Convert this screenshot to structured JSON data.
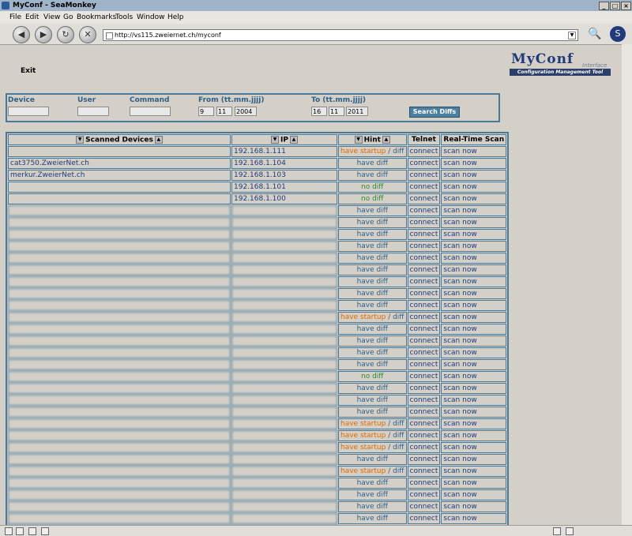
{
  "browser": {
    "title": "MyConf - SeaMonkey",
    "menus": [
      "File",
      "Edit",
      "View",
      "Go",
      "Bookmarks",
      "Tools",
      "Window",
      "Help"
    ],
    "url": "http://vs115.zweiernet.ch/myconf"
  },
  "page": {
    "exit_label": "Exit",
    "logo": {
      "name": "MyConf",
      "interface": "Interface",
      "tagline": "Configuration Management Tool"
    }
  },
  "filter": {
    "device_label": "Device",
    "user_label": "User",
    "command_label": "Command",
    "from_label": "From (tt.mm.jjjj)",
    "to_label": "To (tt.mm.jjjj)",
    "from": {
      "day": "9",
      "month": "11",
      "year": "2004"
    },
    "to": {
      "day": "16",
      "month": "11",
      "year": "2011"
    },
    "search_button": "Search Diffs"
  },
  "table": {
    "headers": {
      "device": "Scanned Devices",
      "ip": "IP",
      "hint": "Hint",
      "telnet": "Telnet",
      "scan": "Real-Time Scan"
    },
    "connect_label": "connect",
    "scan_label": "scan now",
    "rows": [
      {
        "device": "",
        "ip": "192.168.1.111",
        "hint": "have startup",
        "diff": "diff",
        "hint_color": "#e06b00"
      },
      {
        "device": "cat3750.ZweierNet.ch",
        "ip": "192.168.1.104",
        "hint": "have diff",
        "hint_color": "#2e6088"
      },
      {
        "device": "merkur.ZweierNet.ch",
        "ip": "192.168.1.103",
        "hint": "have diff",
        "hint_color": "#2e6088"
      },
      {
        "device": "",
        "ip": "192.168.1.101",
        "hint": "no diff",
        "hint_color": "#2e8b2e"
      },
      {
        "device": "",
        "ip": "192.168.1.100",
        "hint": "no diff",
        "hint_color": "#2e8b2e"
      },
      {
        "device": "",
        "ip": "",
        "hint": "have diff",
        "hint_color": "#2e6088"
      },
      {
        "device": "",
        "ip": "",
        "hint": "have diff",
        "hint_color": "#2e6088"
      },
      {
        "device": "",
        "ip": "",
        "hint": "have diff",
        "hint_color": "#2e6088"
      },
      {
        "device": "",
        "ip": "",
        "hint": "have diff",
        "hint_color": "#2e6088"
      },
      {
        "device": "",
        "ip": "",
        "hint": "have diff",
        "hint_color": "#2e6088"
      },
      {
        "device": "",
        "ip": "",
        "hint": "have diff",
        "hint_color": "#2e6088"
      },
      {
        "device": "",
        "ip": "",
        "hint": "have diff",
        "hint_color": "#2e6088"
      },
      {
        "device": "",
        "ip": "",
        "hint": "have diff",
        "hint_color": "#2e6088"
      },
      {
        "device": "",
        "ip": "",
        "hint": "have diff",
        "hint_color": "#2e6088"
      },
      {
        "device": "",
        "ip": "",
        "hint": "have startup",
        "diff": "diff",
        "hint_color": "#e06b00"
      },
      {
        "device": "",
        "ip": "",
        "hint": "have diff",
        "hint_color": "#2e6088"
      },
      {
        "device": "",
        "ip": "",
        "hint": "have diff",
        "hint_color": "#2e6088"
      },
      {
        "device": "",
        "ip": "",
        "hint": "have diff",
        "hint_color": "#2e6088"
      },
      {
        "device": "",
        "ip": "",
        "hint": "have diff",
        "hint_color": "#2e6088"
      },
      {
        "device": "",
        "ip": "",
        "hint": "no diff",
        "hint_color": "#2e8b2e"
      },
      {
        "device": "",
        "ip": "",
        "hint": "have diff",
        "hint_color": "#2e6088"
      },
      {
        "device": "",
        "ip": "",
        "hint": "have diff",
        "hint_color": "#2e6088"
      },
      {
        "device": "",
        "ip": "",
        "hint": "have diff",
        "hint_color": "#2e6088"
      },
      {
        "device": "",
        "ip": "",
        "hint": "have startup",
        "diff": "diff",
        "hint_color": "#e06b00"
      },
      {
        "device": "",
        "ip": "",
        "hint": "have startup",
        "diff": "diff",
        "hint_color": "#e06b00"
      },
      {
        "device": "",
        "ip": "",
        "hint": "have startup",
        "diff": "diff",
        "hint_color": "#e06b00"
      },
      {
        "device": "",
        "ip": "",
        "hint": "have diff",
        "hint_color": "#2e6088"
      },
      {
        "device": "",
        "ip": "",
        "hint": "have startup",
        "diff": "diff",
        "hint_color": "#e06b00"
      },
      {
        "device": "",
        "ip": "",
        "hint": "have diff",
        "hint_color": "#2e6088"
      },
      {
        "device": "",
        "ip": "",
        "hint": "have diff",
        "hint_color": "#2e6088"
      },
      {
        "device": "",
        "ip": "",
        "hint": "have diff",
        "hint_color": "#2e6088"
      },
      {
        "device": "",
        "ip": "",
        "hint": "have diff",
        "hint_color": "#2e6088"
      },
      {
        "device": "",
        "ip": "",
        "hint": "no diff",
        "hint_color": "#2e8b2e"
      },
      {
        "device": "",
        "ip": "",
        "hint": "no diff",
        "hint_color": "#2e8b2e"
      }
    ]
  }
}
